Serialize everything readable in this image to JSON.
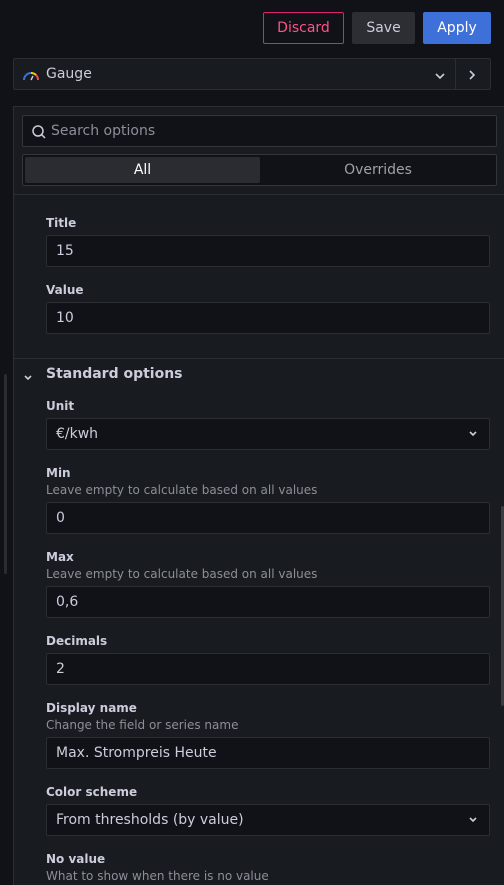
{
  "toolbar": {
    "discard": "Discard",
    "save": "Save",
    "apply": "Apply"
  },
  "visualization": {
    "name": "Gauge",
    "icon": "gauge-icon"
  },
  "search": {
    "placeholder": "Search options"
  },
  "tabs": {
    "all": "All",
    "overrides": "Overrides"
  },
  "fields": {
    "title": {
      "label": "Title",
      "value": "15"
    },
    "value": {
      "label": "Value",
      "value": "10"
    }
  },
  "standard_options": {
    "header": "Standard options",
    "unit": {
      "label": "Unit",
      "value": "€/kwh"
    },
    "min": {
      "label": "Min",
      "description": "Leave empty to calculate based on all values",
      "value": "0"
    },
    "max": {
      "label": "Max",
      "description": "Leave empty to calculate based on all values",
      "value": "0,6"
    },
    "decimals": {
      "label": "Decimals",
      "value": "2"
    },
    "display_name": {
      "label": "Display name",
      "description": "Change the field or series name",
      "value": "Max. Strompreis Heute"
    },
    "color_scheme": {
      "label": "Color scheme",
      "value": "From thresholds (by value)"
    },
    "no_value": {
      "label": "No value",
      "description": "What to show when there is no value"
    }
  },
  "colors": {
    "discard": "#ff5286",
    "apply": "#3d71d9",
    "background": "#111217",
    "panel": "#181b1f"
  }
}
